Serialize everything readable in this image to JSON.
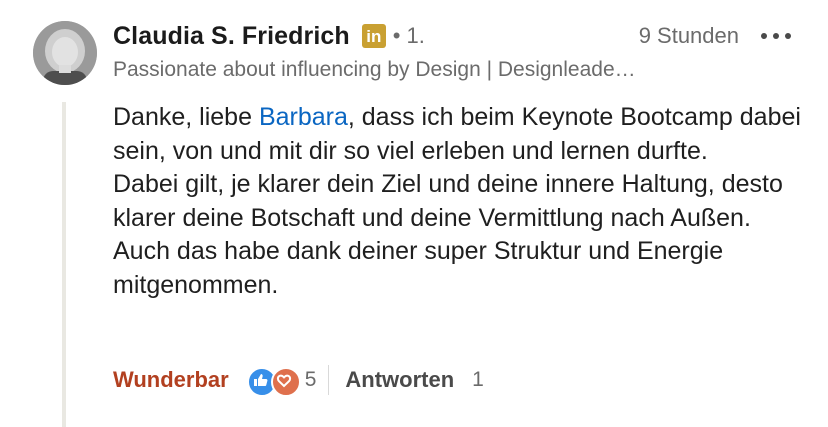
{
  "comment": {
    "author": {
      "name": "Claudia S. Friedrich",
      "badge_icon": "linkedin-premium-icon",
      "badge_text": "in",
      "badge_color": "#c9a032",
      "separator": "•",
      "connection_degree": "1.",
      "headline": "Passionate about influencing by Design | Designleade…"
    },
    "timestamp": "9 Stunden",
    "more_icon": "more-horizontal-icon",
    "body": {
      "p1_before_mention": "Danke, liebe ",
      "mention": "Barbara",
      "p1_after_mention": ", dass ich beim Keynote Bootcamp dabei sein, von und mit dir so viel erleben und lernen durfte.",
      "p2": "Dabei gilt, je klarer dein Ziel und deine innere Haltung, desto klarer deine Botschaft und deine Vermittlung nach Außen. Auch das habe dank deiner super Struktur und Energie mitgenommen."
    },
    "actions": {
      "reaction_label": "Wunderbar",
      "reaction_icons": [
        "like-icon",
        "love-icon"
      ],
      "reaction_count": "5",
      "reply_label": "Antworten",
      "reply_count": "1"
    }
  },
  "colors": {
    "mention": "#0a66c2",
    "reaction_active": "#b24020",
    "like": "#378fe9",
    "love": "#df704d",
    "muted_text": "#6b6b6b",
    "thread_line": "#e9e8e2"
  }
}
